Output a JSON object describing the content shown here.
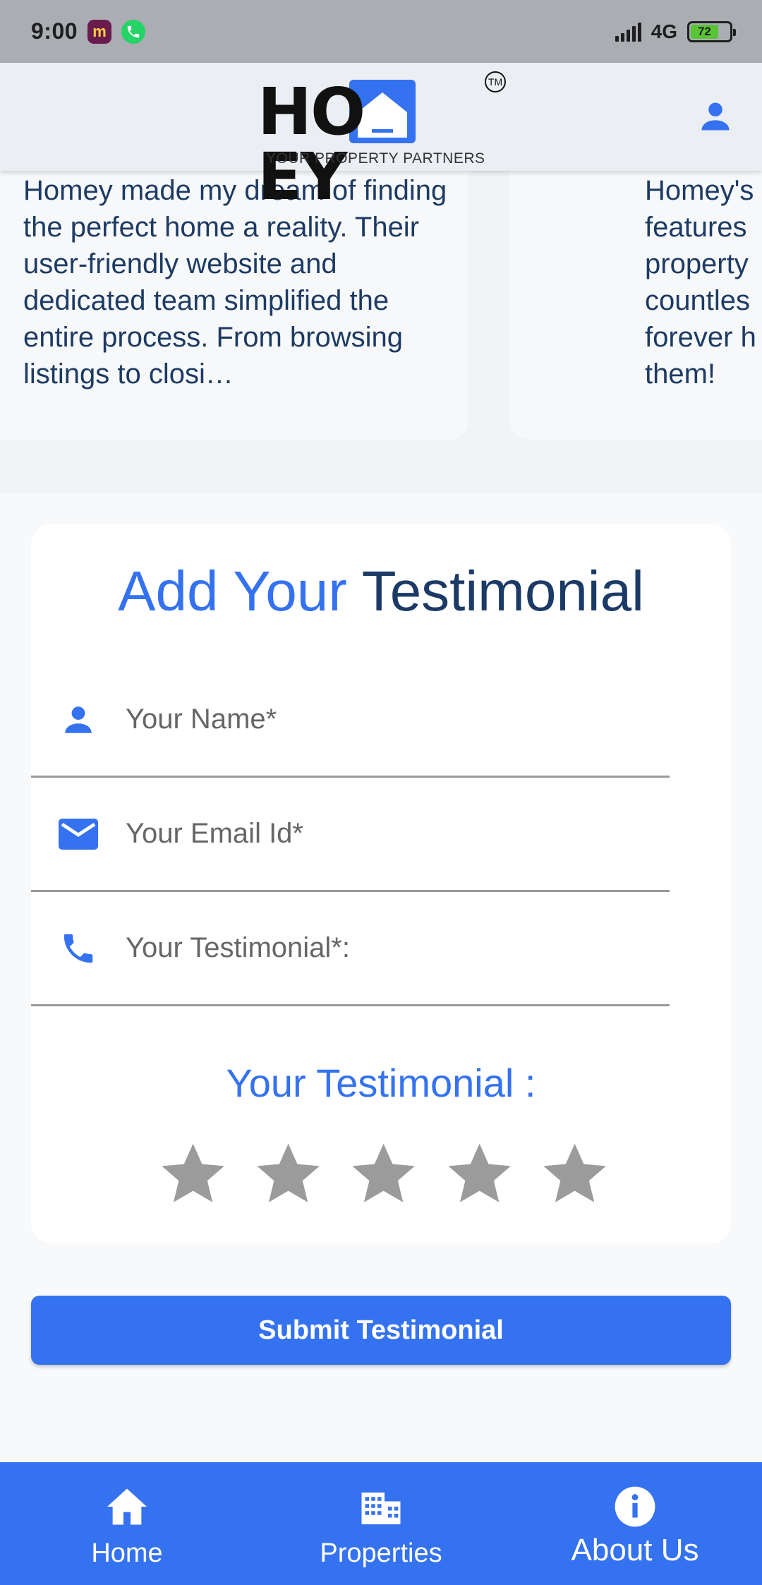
{
  "status_bar": {
    "time": "9:00",
    "app_icon_1_glyph": "m",
    "network": "4G",
    "battery": "72"
  },
  "header": {
    "logo_text": "HO EY",
    "logo_tagline": "YOUR PROPERTY PARTNERS",
    "logo_tm": "TM",
    "profile_icon": "person-icon"
  },
  "testimonials": [
    {
      "text": "Homey made my dream of finding the perfect home a reality. Their user-friendly website and dedicated team simplified the entire process. From browsing listings to closi…"
    },
    {
      "text": "Homey's\nfeatures\nproperty\ncountles\nforever h\nthem!"
    }
  ],
  "form": {
    "title_accent": "Add Your",
    "title_dark": "Testimonial",
    "name_placeholder": "Your Name*",
    "email_placeholder": "Your Email Id*",
    "testimonial_placeholder": "Your Testimonial*:",
    "rating_label": "Your Testimonial :",
    "rating_value": 0,
    "rating_max": 5,
    "submit_label": "Submit Testimonial"
  },
  "bottom_nav": {
    "home": "Home",
    "properties": "Properties",
    "about": "About Us"
  },
  "colors": {
    "primary": "#3572f0",
    "dark_text": "#1b3a66",
    "star_inactive": "#9b9b9b"
  }
}
